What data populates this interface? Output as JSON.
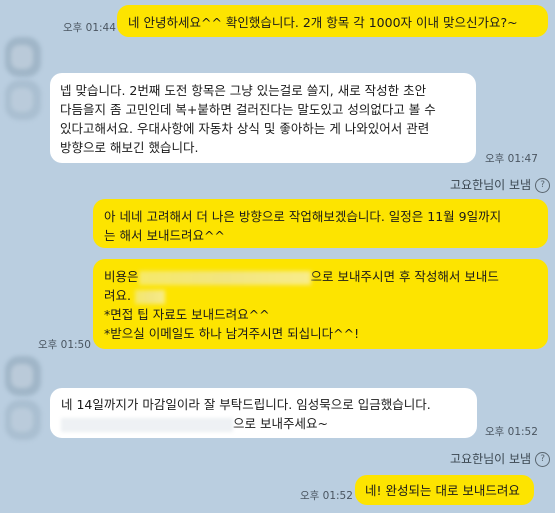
{
  "messages": {
    "m1": {
      "time": "오후 01:44",
      "text": "네 안녕하세요^^ 확인했습니다. 2개 항목 각 1000자 이내 맞으신가요?~"
    },
    "m2": {
      "lines": [
        "넵 맞습니다. 2번째 도전 항목은 그냥 있는걸로 쓸지, 새로 작성한 초안",
        "다듬을지 좀 고민인데 복+붙하면 걸러진다는 말도있고 성의없다고 볼 수",
        "있다고해서요. 우대사항에 자동차 상식 및 좋아하는 게 나와있어서 관련",
        "방향으로 해보긴 했습니다."
      ],
      "time": "오후 01:47"
    },
    "note1": {
      "text": "고요한님이 보냄"
    },
    "m3": {
      "lines": [
        "아 네네 고려해서 더 나은 방향으로 작업해보겠습니다. 일정은 11월 9일까지",
        "는 해서 보내드려요^^"
      ]
    },
    "m4": {
      "line1_prefix": "비용은",
      "line1_suffix": "으로 보내주시면 후 작성해서 보내드",
      "line2": "려요.",
      "line3": "*면접 팁 자료도 보내드려요^^",
      "line4": "*받으실 이메일도 하나 남겨주시면 되십니다^^!",
      "time": "오후 01:50"
    },
    "m5": {
      "line1": "네 14일까지가 마감일이라 잘 부탁드립니다. 임성묵으로 입금했습니다.",
      "line2_suffix": "으로 보내주세요~",
      "time": "오후 01:52"
    },
    "note2": {
      "text": "고요한님이 보냄"
    },
    "m6": {
      "time": "오후 01:52",
      "text": "네! 완성되는 대로 보내드려요"
    }
  },
  "colors": {
    "background": "#bacee0",
    "my_bubble": "#fde400",
    "their_bubble": "#ffffff"
  },
  "icons": {
    "help": "question-circle-icon"
  },
  "help_glyph": "?"
}
